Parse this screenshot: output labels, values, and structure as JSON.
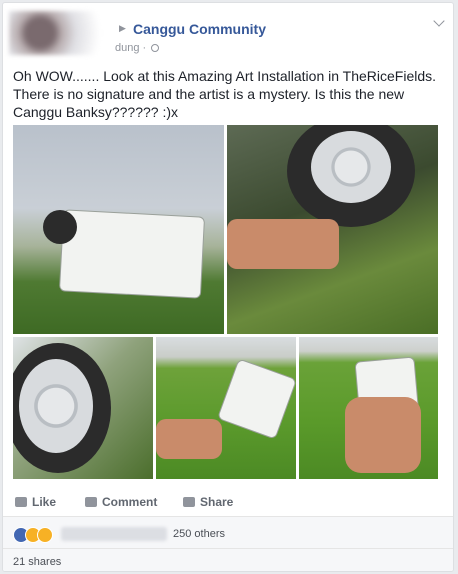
{
  "post": {
    "group": "Canggu Community",
    "meta": "dung ·",
    "text": "Oh WOW....... Look at this Amazing Art Installation in TheRiceFields. There is no signature and the artist is a mystery. Is this the new Canggu Banksy?????? :)x"
  },
  "actions": {
    "like": "Like",
    "comment": "Comment",
    "share": "Share"
  },
  "reactions": {
    "others": "250 others"
  },
  "shares": "21 shares",
  "colors": {
    "link": "#365899",
    "muted": "#90949c",
    "background": "#e9ebee"
  },
  "icons": [
    "globe-icon",
    "chevron-down-icon",
    "like-icon",
    "comment-icon",
    "share-icon"
  ]
}
